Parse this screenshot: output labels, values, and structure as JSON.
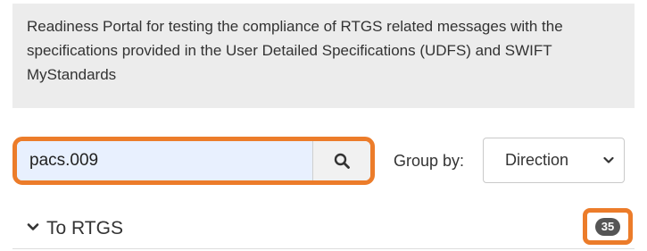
{
  "banner": {
    "text": "Readiness Portal for testing the compliance of RTGS related messages with the specifications provided in the User Detailed Specifications (UDFS) and SWIFT MyStandards"
  },
  "search": {
    "value": "pacs.009",
    "button_icon": "search-icon"
  },
  "group_by": {
    "label": "Group by:",
    "selected": "Direction",
    "icon": "chevron-down-icon"
  },
  "section": {
    "title": "To RTGS",
    "count": "35",
    "icon": "chevron-down-icon"
  },
  "colors": {
    "highlight": "#ec7c2a",
    "banner_bg": "#ececec",
    "badge_bg": "#555555",
    "input_bg": "#e8f0fe"
  }
}
